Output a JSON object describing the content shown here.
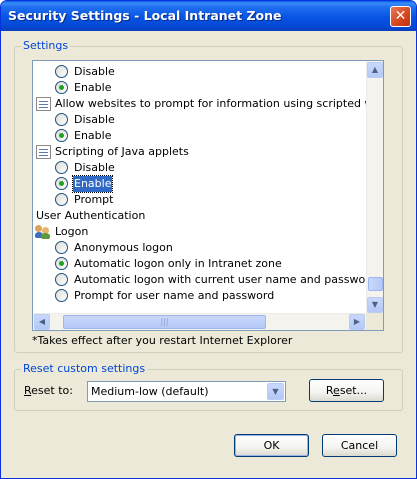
{
  "window": {
    "title": "Security Settings - Local Intranet Zone",
    "close_glyph": "✕"
  },
  "settings_group": {
    "legend": "Settings",
    "rows": [
      {
        "kind": "radio",
        "label": "Disable",
        "checked": false
      },
      {
        "kind": "radio",
        "label": "Enable",
        "checked": true
      },
      {
        "kind": "category",
        "label": "Allow websites to prompt for information using scripted windows",
        "icon": "settings-page-icon"
      },
      {
        "kind": "radio",
        "label": "Disable",
        "checked": false
      },
      {
        "kind": "radio",
        "label": "Enable",
        "checked": true
      },
      {
        "kind": "category",
        "label": "Scripting of Java applets",
        "icon": "settings-page-icon"
      },
      {
        "kind": "radio",
        "label": "Disable",
        "checked": false
      },
      {
        "kind": "radio",
        "label": "Enable",
        "checked": true,
        "selected": true
      },
      {
        "kind": "radio",
        "label": "Prompt",
        "checked": false
      },
      {
        "kind": "heading",
        "label": "User Authentication"
      },
      {
        "kind": "category",
        "label": "Logon",
        "icon": "users-icon"
      },
      {
        "kind": "radio",
        "label": "Anonymous logon",
        "checked": false
      },
      {
        "kind": "radio",
        "label": "Automatic logon only in Intranet zone",
        "checked": true
      },
      {
        "kind": "radio",
        "label": "Automatic logon with current user name and password",
        "checked": false
      },
      {
        "kind": "radio",
        "label": "Prompt for user name and password",
        "checked": false
      }
    ],
    "note": "*Takes effect after you restart Internet Explorer"
  },
  "reset_group": {
    "legend": "Reset custom settings",
    "reset_to_label": "Reset to:",
    "combo_value": "Medium-low (default)",
    "reset_button": "Reset..."
  },
  "buttons": {
    "ok": "OK",
    "cancel": "Cancel"
  },
  "colors": {
    "titlebar": "#0854e3",
    "legend": "#0046d5",
    "selection": "#316ac5",
    "radio_dot": "#21a121"
  }
}
